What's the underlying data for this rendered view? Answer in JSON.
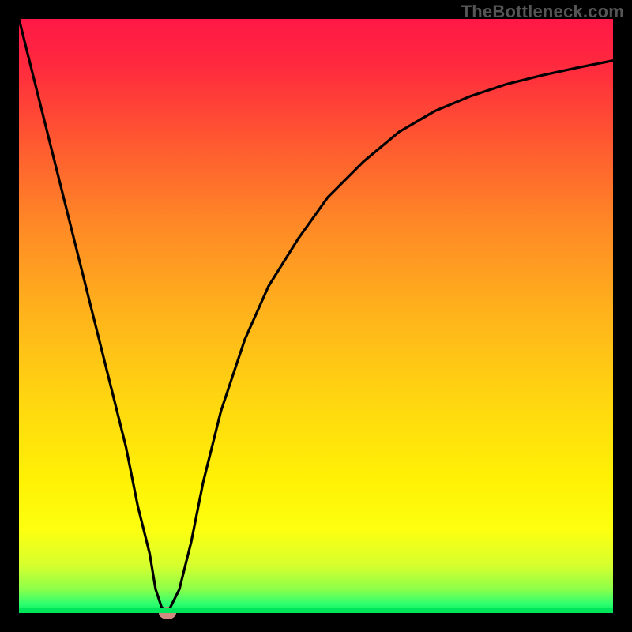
{
  "watermark": "TheBottleneck.com",
  "colors": {
    "curve": "#000000",
    "marker": "#d08a80",
    "frame": "#000000"
  },
  "gradient_stops": [
    {
      "offset": 0.0,
      "color": "#ff1846"
    },
    {
      "offset": 0.08,
      "color": "#ff2a3e"
    },
    {
      "offset": 0.2,
      "color": "#ff5631"
    },
    {
      "offset": 0.35,
      "color": "#ff8a26"
    },
    {
      "offset": 0.5,
      "color": "#ffb41b"
    },
    {
      "offset": 0.65,
      "color": "#ffd80f"
    },
    {
      "offset": 0.78,
      "color": "#fff205"
    },
    {
      "offset": 0.86,
      "color": "#fdff10"
    },
    {
      "offset": 0.92,
      "color": "#d6ff2e"
    },
    {
      "offset": 0.96,
      "color": "#8cff4a"
    },
    {
      "offset": 0.985,
      "color": "#2dff70"
    },
    {
      "offset": 1.0,
      "color": "#00e65b"
    }
  ],
  "chart_data": {
    "type": "line",
    "title": "",
    "xlabel": "",
    "ylabel": "",
    "xlim": [
      0,
      100
    ],
    "ylim": [
      0,
      100
    ],
    "grid": false,
    "legend": false,
    "annotations": [
      "TheBottleneck.com"
    ],
    "series": [
      {
        "name": "bottleneck-curve",
        "x": [
          0,
          3,
          6,
          9,
          12,
          15,
          18,
          20,
          22,
          23,
          24,
          25,
          27,
          29,
          31,
          34,
          38,
          42,
          47,
          52,
          58,
          64,
          70,
          76,
          82,
          88,
          94,
          100
        ],
        "y": [
          100,
          88,
          76,
          64,
          52,
          40,
          28,
          18,
          10,
          4,
          1,
          0,
          4,
          12,
          22,
          34,
          46,
          55,
          63,
          70,
          76,
          81,
          84.5,
          87,
          89,
          90.5,
          91.8,
          93
        ]
      }
    ],
    "marker": {
      "x": 25,
      "y": 0
    }
  }
}
